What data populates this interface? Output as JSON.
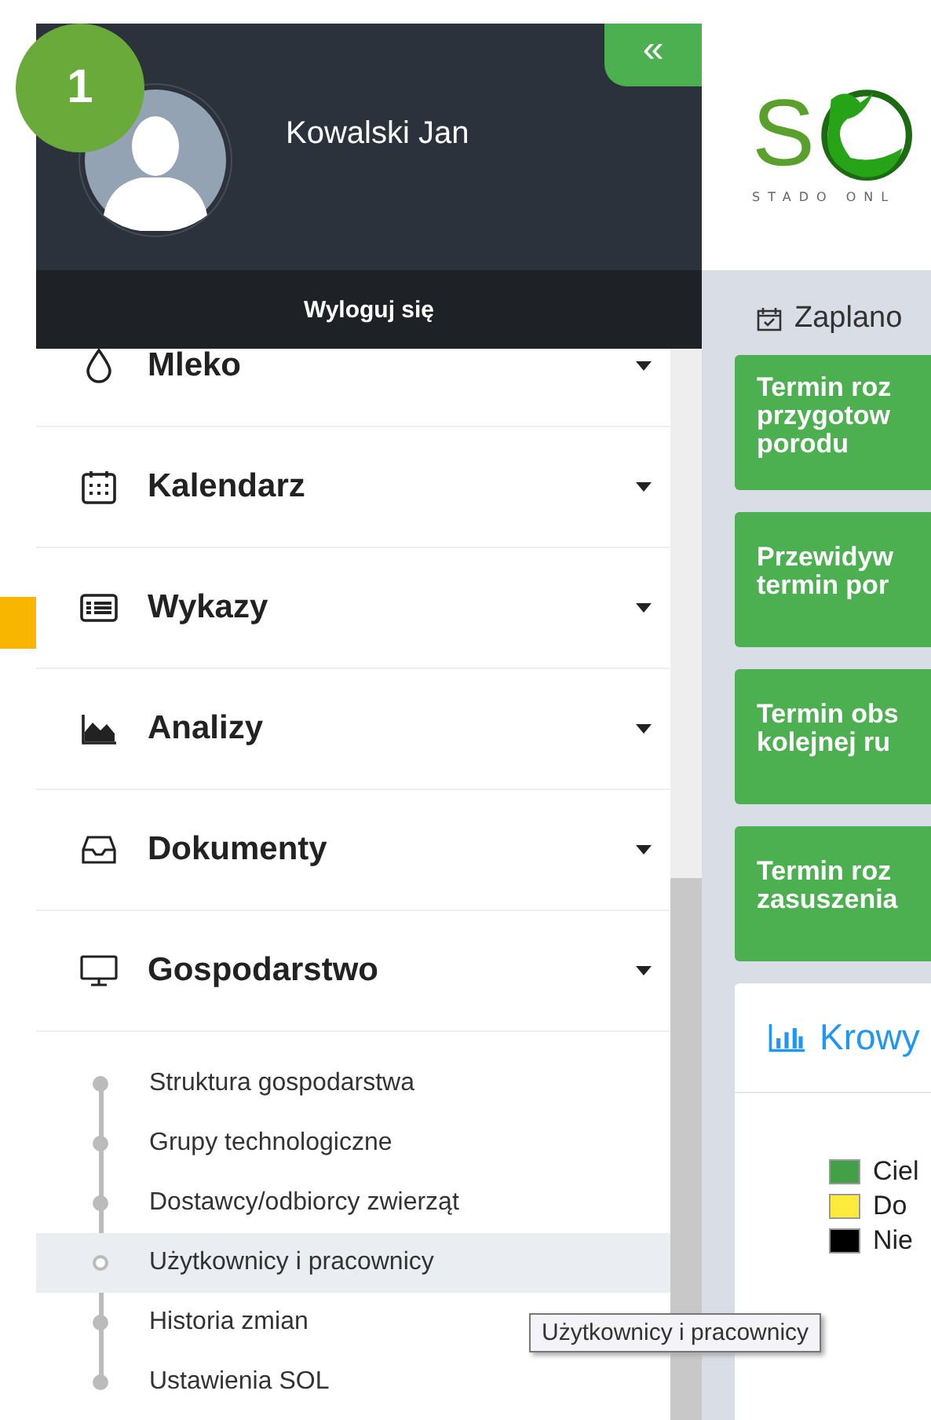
{
  "badge": "1",
  "user": {
    "name": "Kowalski Jan",
    "logout": "Wyloguj się",
    "collapse": "«"
  },
  "menu": [
    {
      "label": "Mleko"
    },
    {
      "label": "Kalendarz"
    },
    {
      "label": "Wykazy"
    },
    {
      "label": "Analizy"
    },
    {
      "label": "Dokumenty"
    },
    {
      "label": "Gospodarstwo",
      "children": [
        {
          "label": "Struktura gospodarstwa",
          "selected": false
        },
        {
          "label": "Grupy technologiczne",
          "selected": false
        },
        {
          "label": "Dostawcy/odbiorcy zwierząt",
          "selected": false
        },
        {
          "label": "Użytkownicy i pracownicy",
          "selected": true
        },
        {
          "label": "Historia zmian",
          "selected": false
        },
        {
          "label": "Ustawienia SOL",
          "selected": false
        }
      ]
    }
  ],
  "tooltip": "Użytkownicy i pracownicy",
  "logo": {
    "letter": "S",
    "tagline": "STADO ONL"
  },
  "planned": {
    "title": "Zaplano",
    "cards": [
      {
        "lines": [
          "Termin roz",
          "przygotow",
          "porodu"
        ]
      },
      {
        "lines": [
          "Przewidyw",
          "termin por"
        ]
      },
      {
        "lines": [
          "Termin obs",
          "kolejnej ru"
        ]
      },
      {
        "lines": [
          "Termin roz",
          "zasuszenia"
        ]
      }
    ]
  },
  "cows": {
    "title": "Krowy",
    "legend": [
      {
        "label": "Ciel",
        "color": "#43a047"
      },
      {
        "label": "Do",
        "color": "#ffeb3b"
      },
      {
        "label": "Nie",
        "color": "#000000"
      }
    ]
  }
}
